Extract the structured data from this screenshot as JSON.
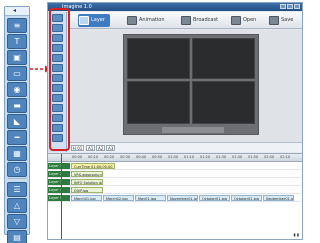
{
  "window": {
    "title": "Imagine 1.0"
  },
  "toolbar": {
    "tabs": [
      {
        "label": "Layer"
      },
      {
        "label": "Animation"
      },
      {
        "label": "Broadcast"
      },
      {
        "label": "Open"
      },
      {
        "label": "Save"
      }
    ]
  },
  "controls": {
    "buttons": [
      "H.01",
      "A1",
      "A2",
      "A3"
    ]
  },
  "timeline": {
    "ticks": [
      "00:00",
      "00:10",
      "00:20",
      "00:30",
      "00:40",
      "00:50",
      "01:00",
      "01:10",
      "01:20",
      "01:30",
      "01:40",
      "01:50",
      "02:00",
      "02:10"
    ],
    "tracks": [
      {
        "name": "Layer 1",
        "clips": [
          {
            "label": "CurrTime 01:00:00.00",
            "style": "c1"
          }
        ]
      },
      {
        "name": "Layer 2",
        "clips": [
          {
            "label": "VRS.www.solo.net",
            "style": "c2"
          }
        ]
      },
      {
        "name": "Layer 3",
        "clips": [
          {
            "label": "INFO Solution data.com",
            "style": "c2"
          }
        ]
      },
      {
        "name": "Layer 4",
        "clips": [
          {
            "label": "DIVP.jpg",
            "style": "c2"
          }
        ]
      },
      {
        "name": "Layer 5",
        "clips": [
          {
            "label": "March01.jpg",
            "style": "img"
          },
          {
            "label": "March02.jpg",
            "style": "img"
          },
          {
            "label": "May01.jpg",
            "style": "img"
          },
          {
            "label": "November01.jpg",
            "style": "img"
          },
          {
            "label": "October01.jpg",
            "style": "img"
          },
          {
            "label": "October02.jpg",
            "style": "img"
          },
          {
            "label": "September01.jpg",
            "style": "img"
          }
        ]
      }
    ],
    "zoom_readout": "▮ ▮"
  },
  "colors": {
    "highlight": "#d62024",
    "accent": "#3f7bc1",
    "track": "#2f7a3e"
  },
  "icons": {
    "left_toolbar": [
      "list-icon",
      "text-icon",
      "image-icon",
      "video-icon",
      "web-icon",
      "counter-icon",
      "rss-icon",
      "line-icon",
      "grid-icon",
      "clock-icon",
      "layers-icon",
      "menu-icon",
      "up-icon",
      "down-icon",
      "fit-icon"
    ]
  }
}
